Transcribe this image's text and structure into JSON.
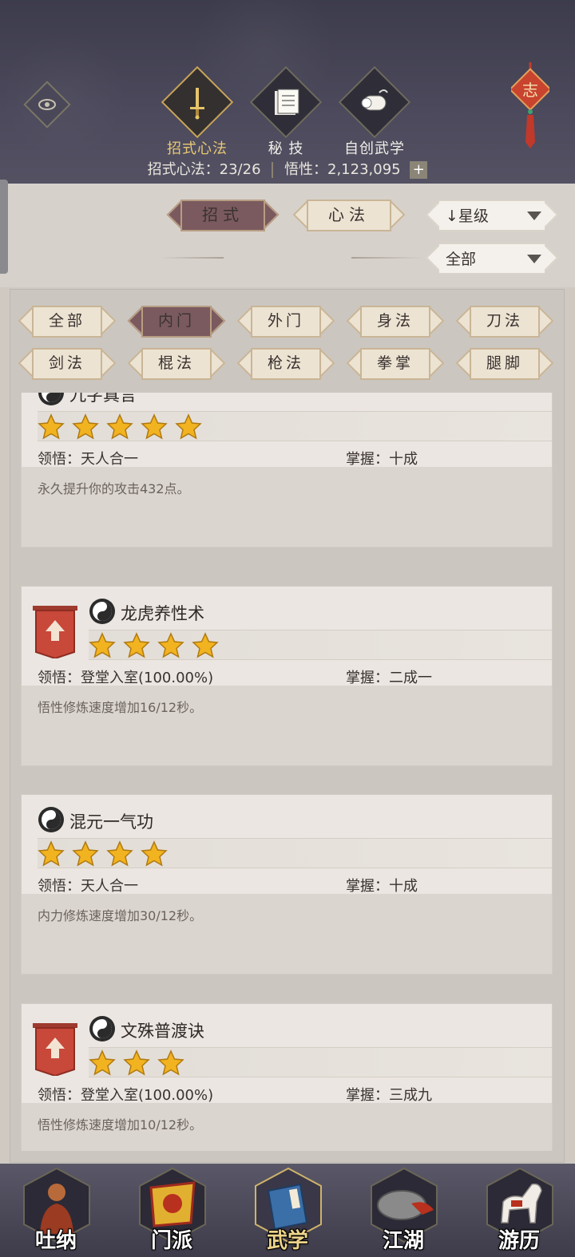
{
  "header": {
    "tabs": [
      {
        "label": "招式心法",
        "icon": "sword-icon",
        "active": true
      },
      {
        "label": "秘 技",
        "icon": "book-icon",
        "active": false
      },
      {
        "label": "自创武学",
        "icon": "scroll-icon",
        "active": false
      }
    ],
    "stats": {
      "moves_label": "招式心法：23/26",
      "insight_label": "悟性：2,123,095",
      "plus": "+"
    },
    "knot_char": "志"
  },
  "type_tabs": [
    {
      "label": "招式",
      "active": true
    },
    {
      "label": "心法",
      "active": false
    }
  ],
  "sort_dropdown": {
    "value": "↓星级"
  },
  "filter_dropdown": {
    "value": "全部"
  },
  "categories": [
    {
      "label": "全部",
      "active": false
    },
    {
      "label": "内门",
      "active": true
    },
    {
      "label": "外门",
      "active": false
    },
    {
      "label": "身法",
      "active": false
    },
    {
      "label": "刀法",
      "active": false
    },
    {
      "label": "剑法",
      "active": false
    },
    {
      "label": "棍法",
      "active": false
    },
    {
      "label": "枪法",
      "active": false
    },
    {
      "label": "拳掌",
      "active": false
    },
    {
      "label": "腿脚",
      "active": false
    }
  ],
  "skills": [
    {
      "name": "九字真言",
      "stars": 5,
      "comprehension": "领悟：天人合一",
      "mastery": "掌握：十成",
      "description": "永久提升你的攻击432点。",
      "upgrade": false
    },
    {
      "name": "龙虎养性术",
      "stars": 4,
      "comprehension": "领悟：登堂入室(100.00%)",
      "mastery": "掌握：二成一",
      "description": "悟性修炼速度增加16/12秒。",
      "upgrade": true
    },
    {
      "name": "混元一气功",
      "stars": 4,
      "comprehension": "领悟：天人合一",
      "mastery": "掌握：十成",
      "description": "内力修炼速度增加30/12秒。",
      "upgrade": false
    },
    {
      "name": "文殊普渡诀",
      "stars": 3,
      "comprehension": "领悟：登堂入室(100.00%)",
      "mastery": "掌握：三成九",
      "description": "悟性修炼速度增加10/12秒。",
      "upgrade": true
    }
  ],
  "bottom_nav": [
    {
      "label": "吐纳",
      "icon": "monk-icon",
      "active": false
    },
    {
      "label": "门派",
      "icon": "banner-flag-icon",
      "active": false
    },
    {
      "label": "武学",
      "icon": "manual-book-icon",
      "active": true
    },
    {
      "label": "江湖",
      "icon": "bamboo-hat-icon",
      "active": false
    },
    {
      "label": "游历",
      "icon": "horse-icon",
      "active": false
    }
  ],
  "colors": {
    "header_bg": "#45435a",
    "active_pill": "#7a5a5e",
    "gold": "#e8c874",
    "star": "#f2b320"
  }
}
